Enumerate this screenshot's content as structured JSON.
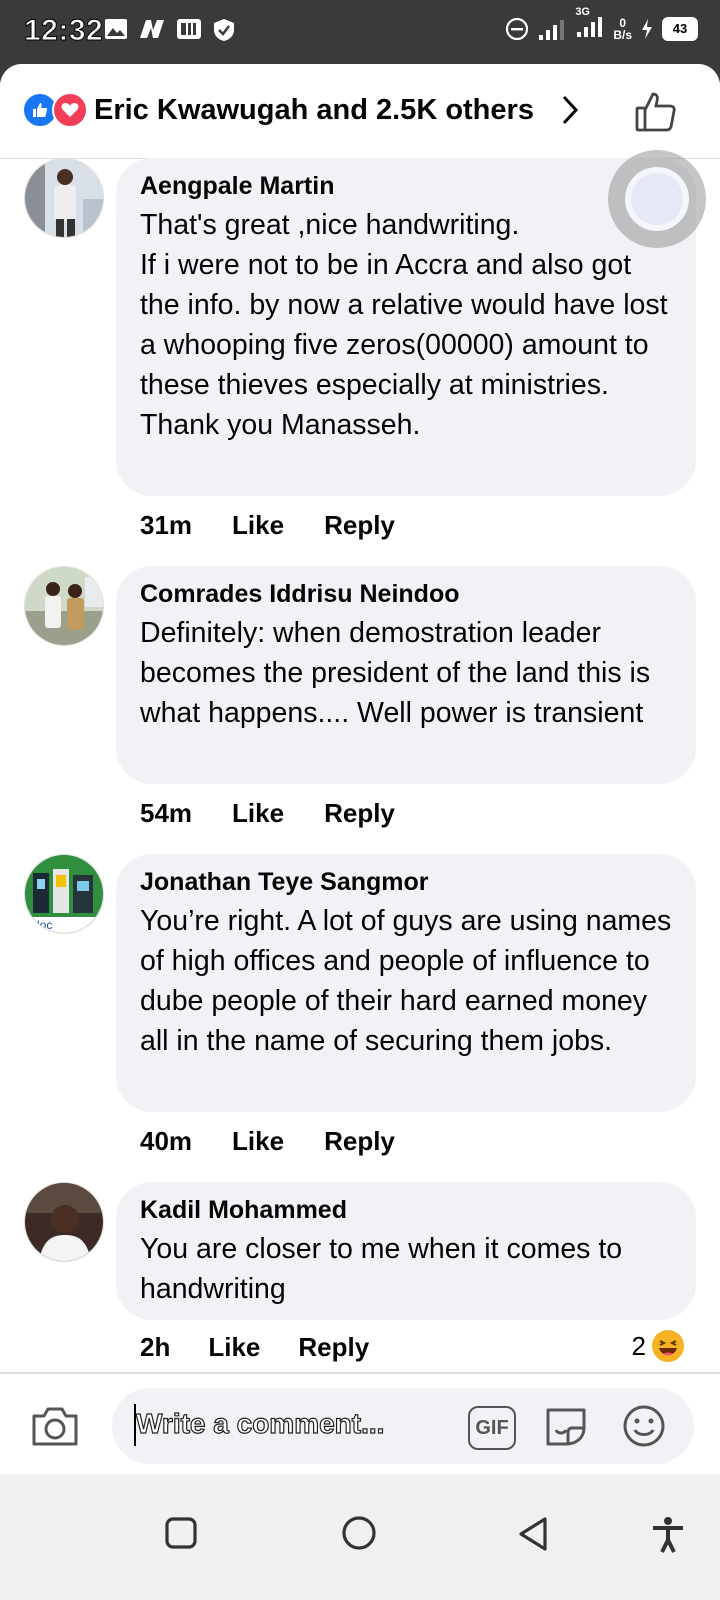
{
  "status_bar": {
    "time": "12:32",
    "network_label": "3G",
    "net_speed_value": "0",
    "net_speed_unit": "B/s",
    "battery": "43"
  },
  "header": {
    "reactions_text": "Eric Kwawugah and 2.5K others",
    "icons": [
      "like-reaction-icon",
      "love-reaction-icon",
      "chevron-right-icon",
      "thumbs-up-outline-icon"
    ]
  },
  "comments": [
    {
      "author": "Aengpale Martin",
      "text": "That's great ,nice handwriting.\nIf i were not to be in Accra and also got the info. by now a relative would have lost a whooping five zeros(00000) amount to these thieves especially at ministries.\nThank you Manasseh.",
      "time": "31m",
      "like": "Like",
      "reply": "Reply"
    },
    {
      "author": "Comrades Iddrisu Neindoo",
      "text": "Definitely: when demostration leader becomes the president of the land this is what happens.... Well power is transient",
      "time": "54m",
      "like": "Like",
      "reply": "Reply"
    },
    {
      "author": "Jonathan Teye Sangmor",
      "text": "You’re right. A lot of guys are using names of high offices and people of influence to dube people of their hard earned money all in the name of securing them jobs.",
      "time": "40m",
      "like": "Like",
      "reply": "Reply"
    },
    {
      "author": "Kadil Mohammed",
      "text": "You are closer to me when it comes to handwriting",
      "time": "2h",
      "like": "Like",
      "reply": "Reply",
      "reaction_count": "2",
      "reaction_icon": "laughing-emoji-icon"
    }
  ],
  "composer": {
    "placeholder": "Write a comment...",
    "gif_label": "GIF",
    "icons": [
      "camera-icon",
      "sticker-icon",
      "emoji-icon"
    ]
  },
  "navbar": {
    "icons": [
      "recents-square-icon",
      "home-circle-icon",
      "back-triangle-icon",
      "accessibility-icon"
    ]
  },
  "colors": {
    "bubble_bg": "#f0f2f5",
    "like_blue": "#1877f2",
    "love_red": "#f33e58",
    "status_bar_bg": "#3a3a3a"
  }
}
